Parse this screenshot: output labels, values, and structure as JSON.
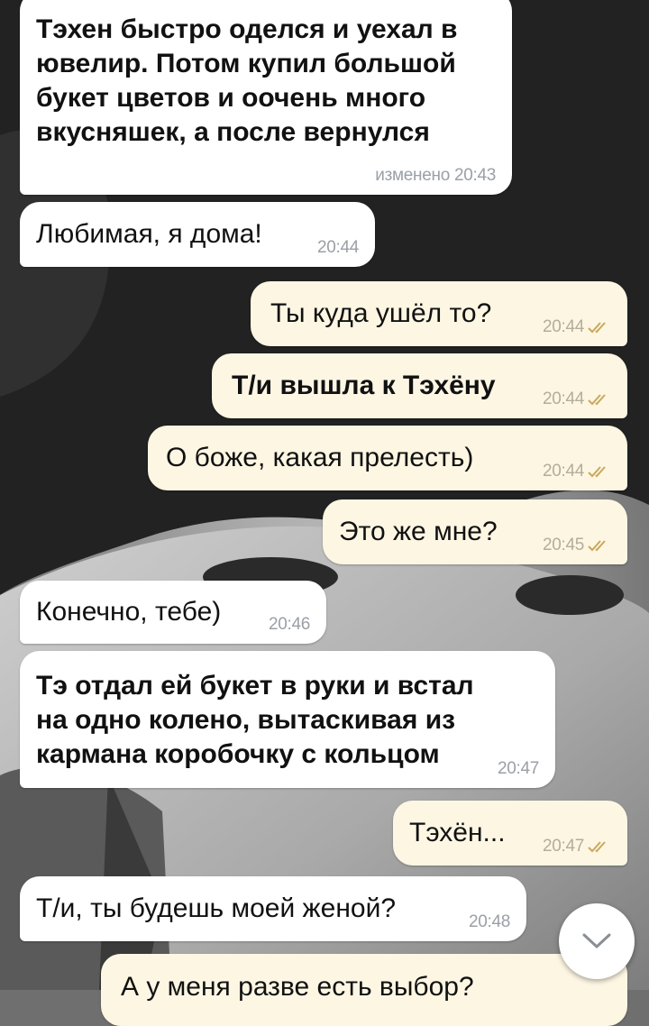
{
  "messages": [
    {
      "side": "in",
      "text": "Тэхен быстро оделся и уехал в ювелир. Потом купил большой букет цветов и оочень много вкусняшек, а после вернулся",
      "time": "изменено 20:43",
      "bold": true
    },
    {
      "side": "in",
      "text": "Любимая, я дома!",
      "time": "20:44",
      "bold": false
    },
    {
      "side": "out",
      "text": "Ты куда ушёл то?",
      "time": "20:44",
      "bold": false,
      "read": true
    },
    {
      "side": "out",
      "text": "Т/и вышла к Тэхёну",
      "time": "20:44",
      "bold": true,
      "read": true
    },
    {
      "side": "out",
      "text": "О боже, какая прелесть)",
      "time": "20:44",
      "bold": false,
      "read": true
    },
    {
      "side": "out",
      "text": "Это же мне?",
      "time": "20:45",
      "bold": false,
      "read": true
    },
    {
      "side": "in",
      "text": "Конечно, тебе)",
      "time": "20:46",
      "bold": false
    },
    {
      "side": "in",
      "text": "Тэ отдал ей букет в руки и встал на одно колено, вытаскивая из кармана коробочку с кольцом",
      "time": "20:47",
      "bold": true
    },
    {
      "side": "out",
      "text": "Тэхён...",
      "time": "20:47",
      "bold": false,
      "read": true
    },
    {
      "side": "in",
      "text": "Т/и, ты будешь моей женой?",
      "time": "20:48",
      "bold": false
    },
    {
      "side": "out",
      "text": "А у меня разве есть выбор?",
      "time": "",
      "bold": false,
      "read": false
    }
  ],
  "icons": {
    "read_receipt": "double-check-icon",
    "scroll_down": "chevron-down-icon"
  },
  "colors": {
    "incoming_bubble": "#ffffff",
    "outgoing_bubble": "#fdf6e3",
    "read_check": "#c8a95e",
    "timestamp": "#9aa0a6"
  }
}
